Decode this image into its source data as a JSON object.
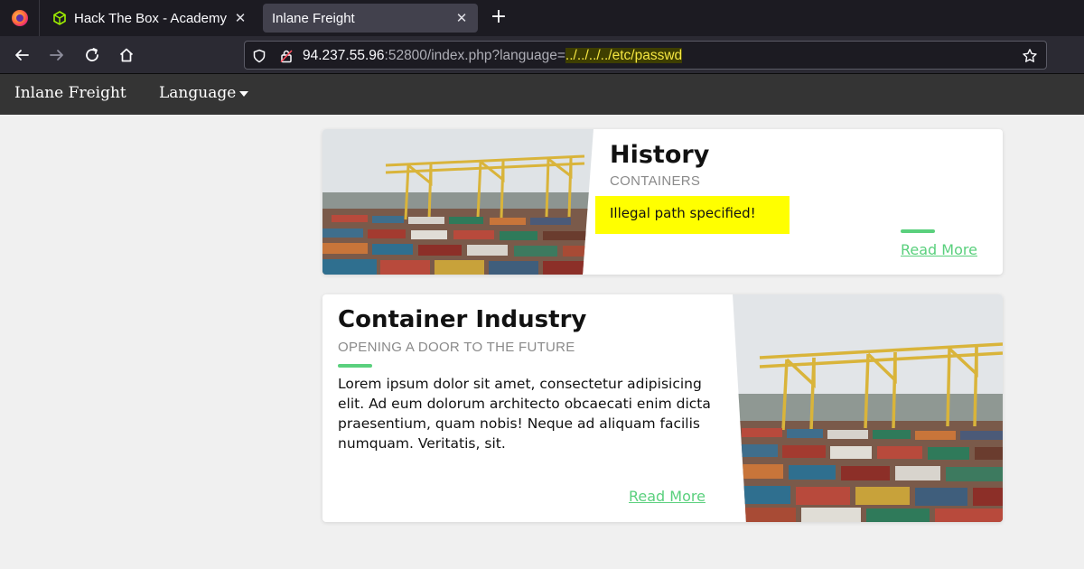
{
  "browser": {
    "tabs": [
      {
        "title": "Hack The Box - Academy",
        "icon": "htb-cube-icon",
        "active": false
      },
      {
        "title": "Inlane Freight",
        "icon": "",
        "active": true
      }
    ],
    "url": {
      "host": "94.237.55.96",
      "rest": ":52800/index.php?language=",
      "highlighted": "../../../../etc/passwd"
    }
  },
  "site": {
    "brand": "Inlane Freight",
    "language_menu": "Language"
  },
  "cards": [
    {
      "title": "History",
      "subtitle": "CONTAINERS",
      "alert": "Illegal path specified!",
      "read_more": "Read More"
    },
    {
      "title": "Container Industry",
      "subtitle": "OPENING A DOOR TO THE FUTURE",
      "body": "Lorem ipsum dolor sit amet, consectetur adipisicing elit. Ad eum dolorum architecto obcaecati enim dicta praesentium, quam nobis! Neque ad aliquam facilis numquam. Veritatis, sit.",
      "read_more": "Read More"
    }
  ],
  "colors": {
    "accent": "#5ad07d",
    "alert_bg": "#ffff00",
    "site_nav": "#343434"
  }
}
